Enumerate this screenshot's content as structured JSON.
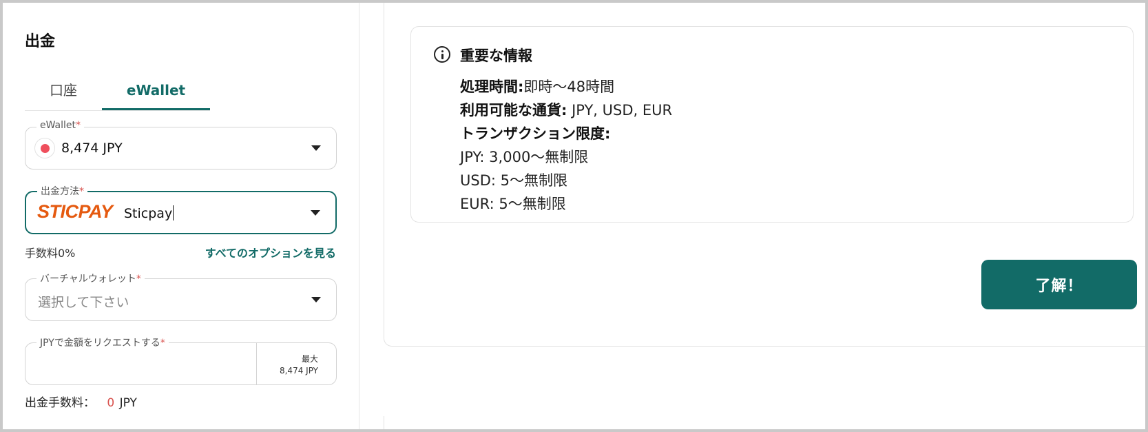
{
  "colors": {
    "accent": "#126b67",
    "required": "#d9534f",
    "sticpay": "#e55a10",
    "currency_dot": "#ef4f5d"
  },
  "left": {
    "title": "出金",
    "tabs": [
      {
        "label": "口座",
        "active": false
      },
      {
        "label": "eWallet",
        "active": true
      }
    ],
    "wallet": {
      "label": "eWallet",
      "required": "*",
      "value": "8,474 JPY",
      "icon": "currency-flag-icon"
    },
    "method": {
      "label": "出金方法",
      "required": "*",
      "logo": "STICPAY",
      "value": "Sticpay",
      "icon": "chevron-down-icon"
    },
    "fee_text": "手数料0%",
    "all_options_link": "すべてのオプションを見る",
    "virtual_wallet": {
      "label": "バーチャルウォレット",
      "required": "*",
      "placeholder": "選択して下さい"
    },
    "amount": {
      "label": "JPYで金額をリクエストする",
      "required": "*",
      "value": "",
      "max_label": "最大",
      "max_value": "8,474 JPY"
    },
    "withdraw_fee": {
      "label": "出金手数料：",
      "amount": "0",
      "unit": "JPY"
    }
  },
  "info": {
    "icon": "info-icon",
    "title": "重要な情報",
    "lines": [
      {
        "key": "処理時間:",
        "value": "即時〜48時間"
      },
      {
        "key": "利用可能な通貨:",
        "value": " JPY, USD, EUR"
      },
      {
        "key": "トランザクション限度:",
        "value": ""
      },
      {
        "key": "",
        "value": "JPY: 3,000〜無制限"
      },
      {
        "key": "",
        "value": "USD: 5〜無制限"
      },
      {
        "key": "",
        "value": "EUR: 5〜無制限"
      }
    ]
  },
  "ok_button": "了解！"
}
